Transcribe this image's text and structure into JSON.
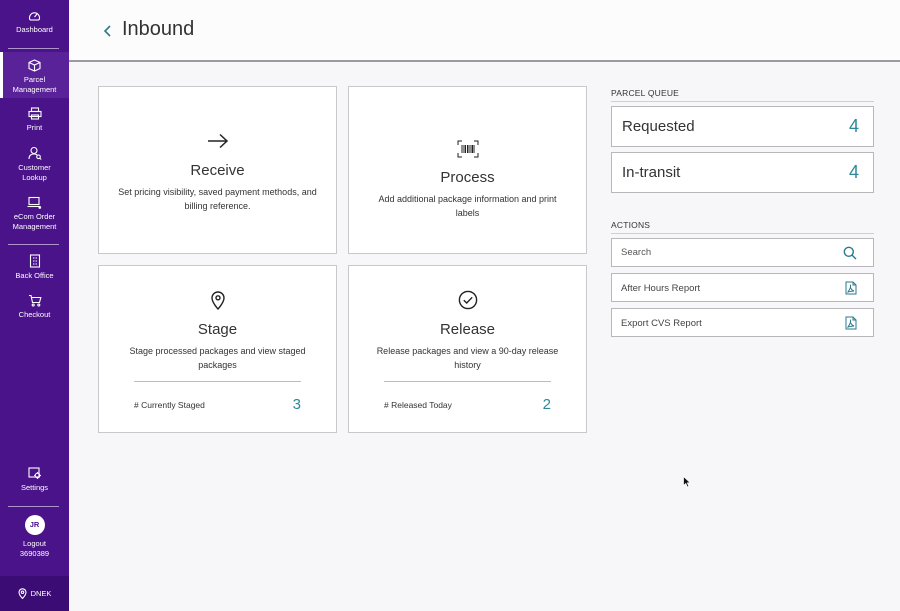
{
  "sidebar": {
    "items": [
      {
        "label": "Dashboard"
      },
      {
        "label": "Parcel Management"
      },
      {
        "label": "Print"
      },
      {
        "label": "Customer Lookup"
      },
      {
        "label": "eCom Order Management"
      },
      {
        "label": "Back Office"
      },
      {
        "label": "Checkout"
      },
      {
        "label": "Settings"
      }
    ],
    "user": {
      "initials": "JR",
      "logout_label": "Logout",
      "user_id": "3690389"
    },
    "location": "DNEK"
  },
  "header": {
    "title": "Inbound"
  },
  "cards": {
    "receive": {
      "title": "Receive",
      "description": "Set pricing visibility, saved payment methods, and billing reference."
    },
    "process": {
      "title": "Process",
      "description": "Add additional package information and print labels"
    },
    "stage": {
      "title": "Stage",
      "description": "Stage processed packages and view staged packages",
      "stat_label": "# Currently Staged",
      "stat_value": "3"
    },
    "release": {
      "title": "Release",
      "description": "Release packages and view a 90-day release history",
      "stat_label": "# Released Today",
      "stat_value": "2"
    }
  },
  "parcel_queue": {
    "heading": "PARCEL QUEUE",
    "items": [
      {
        "label": "Requested",
        "count": "4"
      },
      {
        "label": "In-transit",
        "count": "4"
      }
    ]
  },
  "actions": {
    "heading": "ACTIONS",
    "search_placeholder": "Search",
    "items": [
      {
        "label": "After Hours Report"
      },
      {
        "label": "Export CVS Report"
      }
    ]
  },
  "colors": {
    "sidebar": "#4a1389",
    "accent": "#2b8a98"
  }
}
